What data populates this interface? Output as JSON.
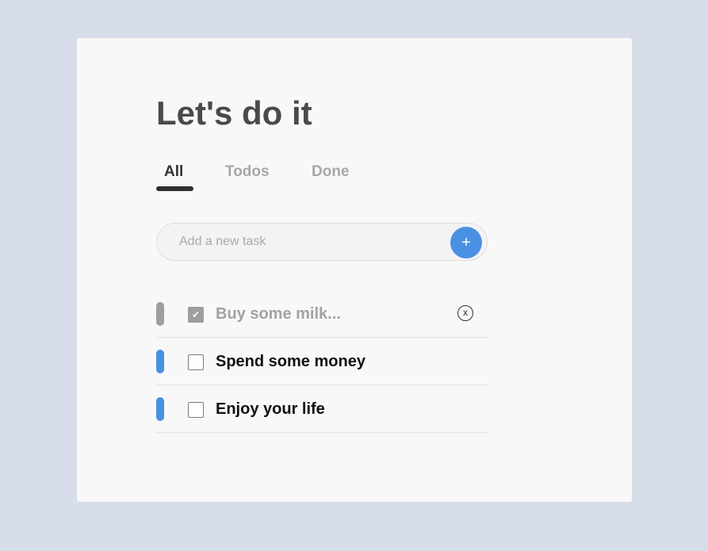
{
  "app": {
    "title": "Let's do it"
  },
  "tabs": [
    {
      "label": "All",
      "active": true
    },
    {
      "label": "Todos",
      "active": false
    },
    {
      "label": "Done",
      "active": false
    }
  ],
  "add_task": {
    "placeholder": "Add a new task",
    "value": "",
    "button_icon": "plus-icon",
    "button_glyph": "+"
  },
  "tasks": [
    {
      "label": "Buy some milk...",
      "done": true,
      "bar_color": "#9e9e9e",
      "delete_glyph": "x"
    },
    {
      "label": "Spend some money",
      "done": false,
      "bar_color": "#4a90e2"
    },
    {
      "label": "Enjoy your life",
      "done": false,
      "bar_color": "#4a90e2"
    }
  ],
  "colors": {
    "background": "#d7dde9",
    "card": "#f8f8f8",
    "accent": "#4a90e2",
    "done_gray": "#9e9e9e"
  }
}
